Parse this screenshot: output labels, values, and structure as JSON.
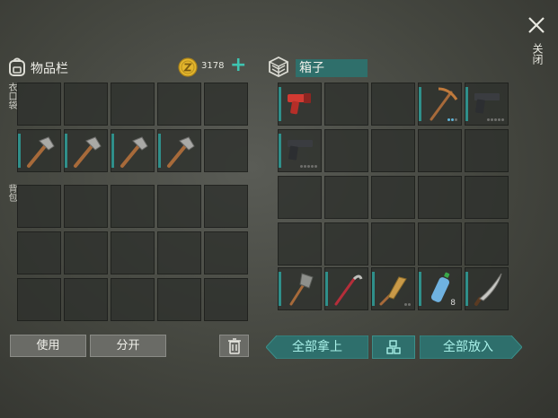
{
  "close": {
    "label": "关闭"
  },
  "inventory": {
    "title": "物品栏",
    "coins": "3178",
    "add": "+",
    "pocket_label": "衣口袋",
    "backpack_label": "背包"
  },
  "box": {
    "title": "箱子"
  },
  "buttons": {
    "use": "使用",
    "split": "分开",
    "take_all": "全部拿上",
    "put_all": "全部放入"
  },
  "box_items": {
    "water_count": "8"
  },
  "colors": {
    "accent": "#2f8f8a",
    "slot_bg": "#2d2f2c",
    "coin": "#e3b52c"
  }
}
